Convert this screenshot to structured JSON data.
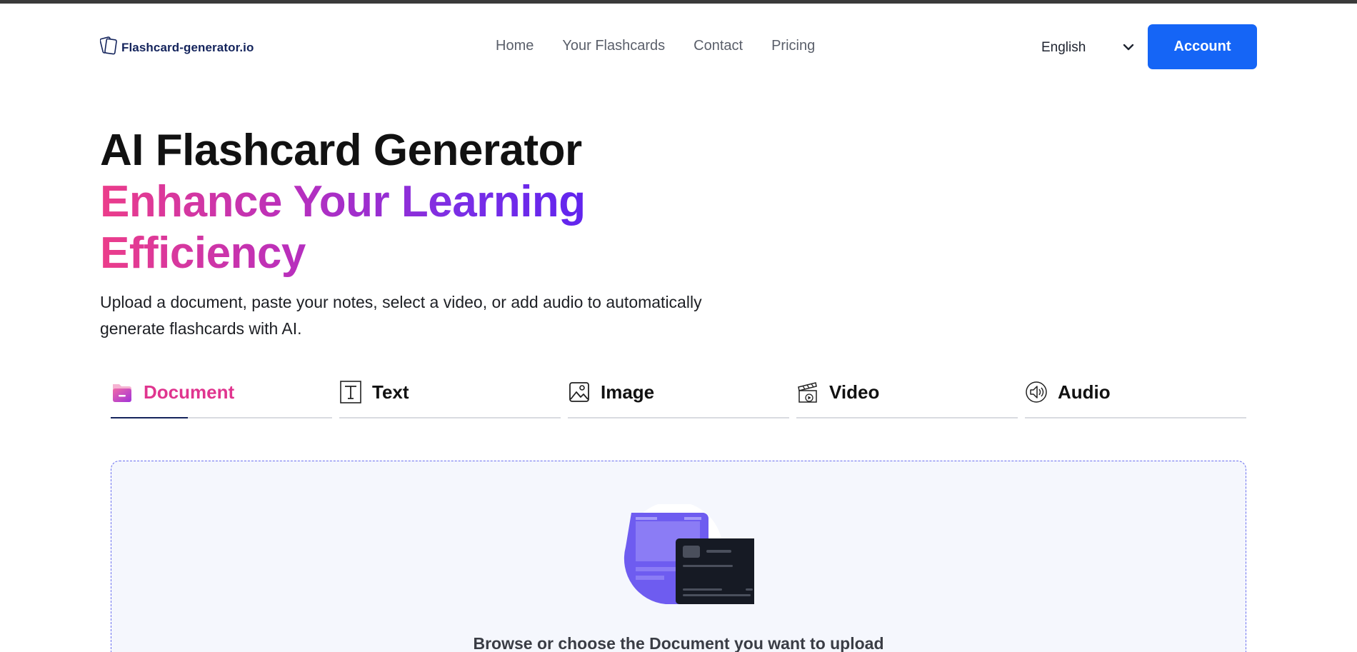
{
  "header": {
    "logo_text": "Flashcard-generator.io",
    "nav": [
      {
        "label": "Home"
      },
      {
        "label": "Your Flashcards"
      },
      {
        "label": "Contact"
      },
      {
        "label": "Pricing"
      }
    ],
    "language": "English",
    "account_label": "Account"
  },
  "hero": {
    "title_line1": "AI Flashcard Generator",
    "title_line2": "Enhance Your Learning Efficiency",
    "subtitle": "Upload a document, paste your notes, select a video, or add audio to automatically generate flashcards with AI."
  },
  "tabs": [
    {
      "label": "Document",
      "icon": "document-folder-icon",
      "active": true
    },
    {
      "label": "Text",
      "icon": "text-icon",
      "active": false
    },
    {
      "label": "Image",
      "icon": "image-icon",
      "active": false
    },
    {
      "label": "Video",
      "icon": "video-clapper-icon",
      "active": false
    },
    {
      "label": "Audio",
      "icon": "speaker-icon",
      "active": false
    }
  ],
  "upload": {
    "prompt": "Browse or choose the Document you want to upload"
  },
  "colors": {
    "accent": "#1565f6",
    "active_tab": "#e0358f",
    "gradient_start": "#ec3d8a",
    "gradient_end": "#5b22f0"
  }
}
